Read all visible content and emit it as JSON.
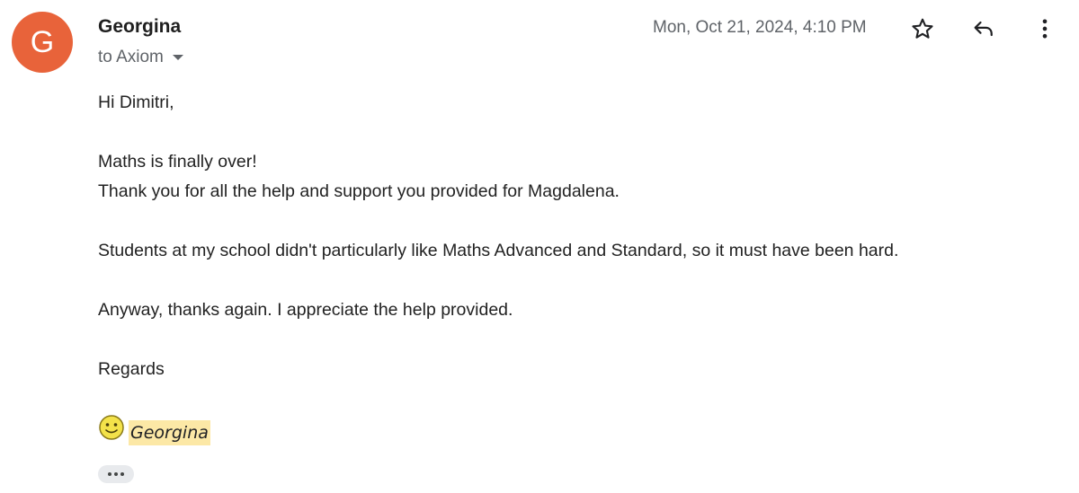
{
  "sender": {
    "avatar_letter": "G",
    "avatar_color": "#e8633a",
    "name": "Georgina",
    "to_label": "to Axiom"
  },
  "header": {
    "timestamp": "Mon, Oct 21, 2024, 4:10 PM",
    "icons": [
      "star-icon",
      "reply-icon",
      "more-vert-icon"
    ]
  },
  "body": {
    "greeting": "Hi Dimitri,",
    "line1": "Maths is finally over!",
    "line2": "Thank you for all the help and support you provided for Magdalena.",
    "line3": "Students at my school didn't particularly like Maths Advanced and Standard, so it must have been hard.",
    "line4": "Anyway, thanks again. I appreciate the help provided.",
    "closing": "Regards"
  },
  "signature": {
    "icon": "smiley-icon",
    "name": "Georgina",
    "highlight_color": "#fce8a6"
  },
  "collapsed_content": {
    "icon": "ellipsis-icon"
  }
}
